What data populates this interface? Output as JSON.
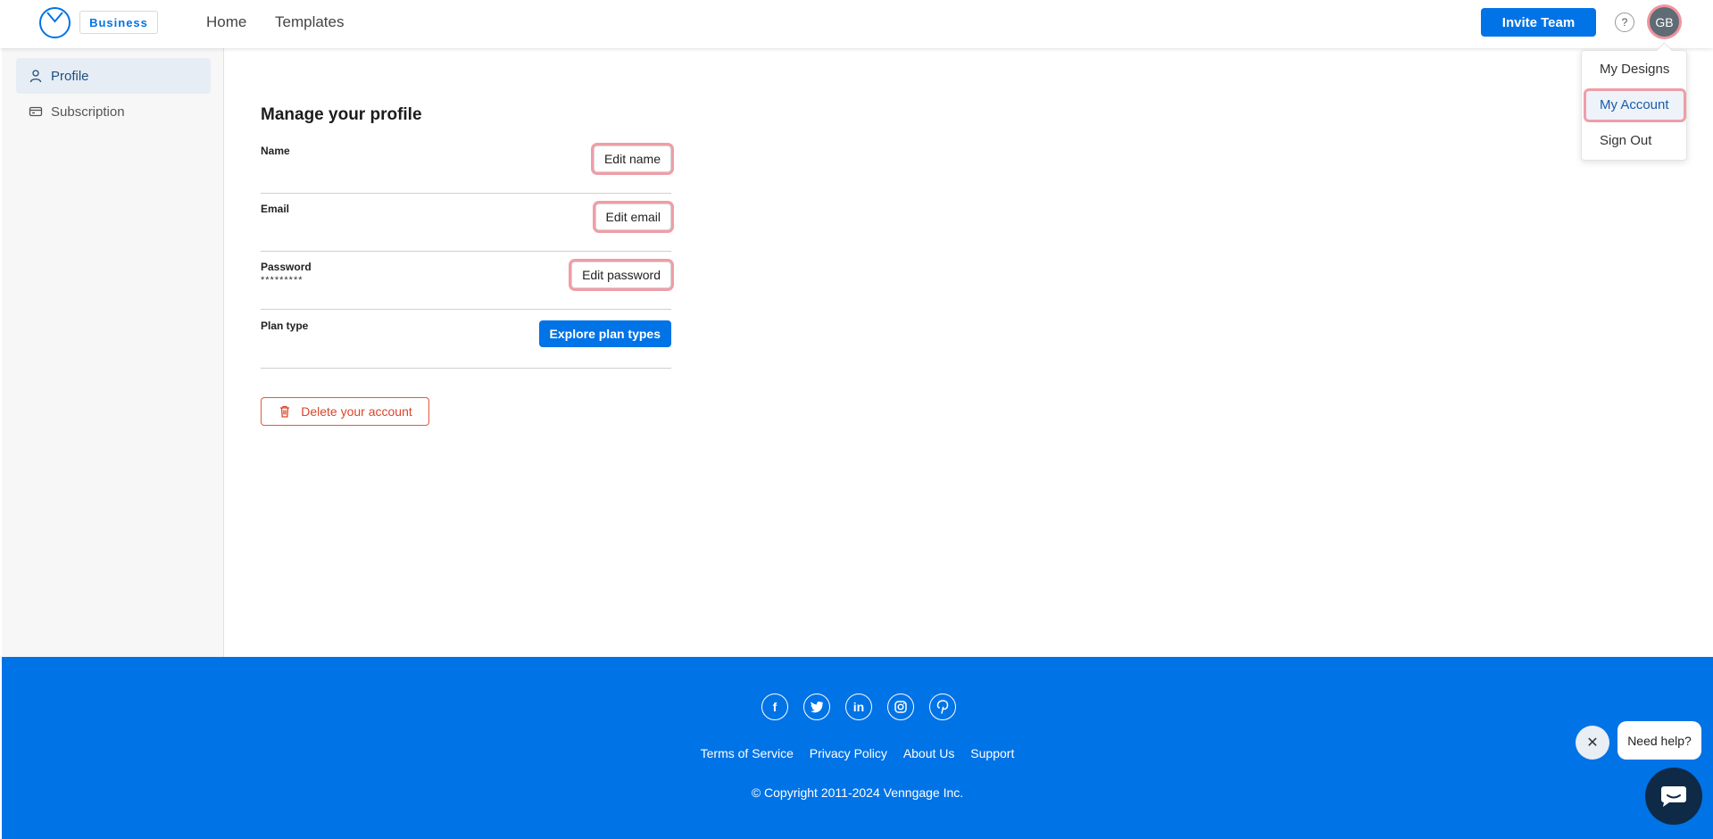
{
  "header": {
    "badge": "Business",
    "nav": {
      "home": "Home",
      "templates": "Templates"
    },
    "invite_label": "Invite Team",
    "help_label": "?",
    "avatar_initials": "GB"
  },
  "dropdown": {
    "my_designs": "My Designs",
    "my_account": "My Account",
    "sign_out": "Sign Out"
  },
  "sidebar": {
    "items": [
      {
        "label": "Profile",
        "icon": "user-icon",
        "active": true
      },
      {
        "label": "Subscription",
        "icon": "card-icon",
        "active": false
      }
    ]
  },
  "main": {
    "title": "Manage your profile",
    "rows": {
      "name": {
        "label": "Name",
        "button": "Edit name"
      },
      "email": {
        "label": "Email",
        "button": "Edit email"
      },
      "password": {
        "label": "Password",
        "value": "*********",
        "button": "Edit password"
      },
      "plan": {
        "label": "Plan type",
        "button": "Explore plan types"
      }
    },
    "delete_label": "Delete your account"
  },
  "footer": {
    "socials": [
      "facebook-icon",
      "twitter-icon",
      "linkedin-icon",
      "instagram-icon",
      "pinterest-icon"
    ],
    "links": [
      "Terms of Service",
      "Privacy Policy",
      "About Us",
      "Support"
    ],
    "copyright": "© Copyright 2011-2024 Venngage Inc."
  },
  "help_widget": {
    "bubble": "Need help?"
  },
  "colors": {
    "primary": "#0073e6",
    "danger": "#d9462b",
    "sidebar_active": "#e6edf5"
  }
}
